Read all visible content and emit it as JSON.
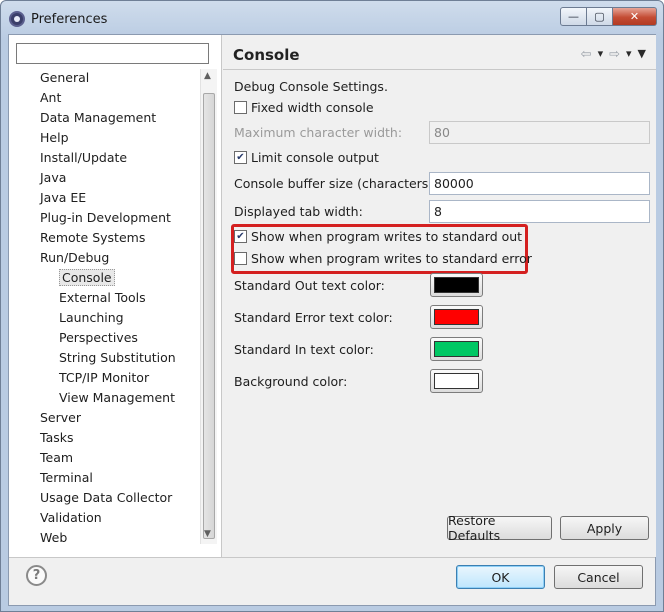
{
  "window": {
    "title": "Preferences",
    "min_glyph": "—",
    "max_glyph": "▢",
    "close_glyph": "✕"
  },
  "filter": {
    "value": "",
    "placeholder": ""
  },
  "tree": {
    "items": [
      {
        "label": "General",
        "level": 0
      },
      {
        "label": "Ant",
        "level": 0
      },
      {
        "label": "Data Management",
        "level": 0
      },
      {
        "label": "Help",
        "level": 0
      },
      {
        "label": "Install/Update",
        "level": 0
      },
      {
        "label": "Java",
        "level": 0
      },
      {
        "label": "Java EE",
        "level": 0
      },
      {
        "label": "Plug-in Development",
        "level": 0
      },
      {
        "label": "Remote Systems",
        "level": 0
      },
      {
        "label": "Run/Debug",
        "level": 0
      },
      {
        "label": "Console",
        "level": 1,
        "selected": true
      },
      {
        "label": "External Tools",
        "level": 1
      },
      {
        "label": "Launching",
        "level": 1
      },
      {
        "label": "Perspectives",
        "level": 1
      },
      {
        "label": "String Substitution",
        "level": 1
      },
      {
        "label": "TCP/IP Monitor",
        "level": 1
      },
      {
        "label": "View Management",
        "level": 1
      },
      {
        "label": "Server",
        "level": 0
      },
      {
        "label": "Tasks",
        "level": 0
      },
      {
        "label": "Team",
        "level": 0
      },
      {
        "label": "Terminal",
        "level": 0
      },
      {
        "label": "Usage Data Collector",
        "level": 0
      },
      {
        "label": "Validation",
        "level": 0
      },
      {
        "label": "Web",
        "level": 0
      }
    ]
  },
  "page": {
    "title": "Console",
    "nav": {
      "back": "⇦",
      "back_menu": "▾",
      "forward": "⇨",
      "forward_menu": "▾",
      "view_menu": "▼"
    },
    "section_label": "Debug Console Settings.",
    "fixed_width": {
      "label": "Fixed width console",
      "checked": false
    },
    "max_char_width": {
      "label": "Maximum character width:",
      "value": "80"
    },
    "limit_output": {
      "label": "Limit console output",
      "checked": true
    },
    "buffer_size": {
      "label": "Console buffer size (characters):",
      "value": "80000"
    },
    "tab_width": {
      "label": "Displayed tab width:",
      "value": "8"
    },
    "show_stdout": {
      "label": "Show when program writes to standard out",
      "checked": true
    },
    "show_stderr": {
      "label": "Show when program writes to standard error",
      "checked": false
    },
    "colors": [
      {
        "label": "Standard Out text color:",
        "color": "#000000"
      },
      {
        "label": "Standard Error text color:",
        "color": "#ff0000"
      },
      {
        "label": "Standard In text color:",
        "color": "#00c864"
      },
      {
        "label": "Background color:",
        "color": "#ffffff"
      }
    ],
    "restore_defaults": "Restore Defaults",
    "apply": "Apply"
  },
  "footer": {
    "help_glyph": "?",
    "ok": "OK",
    "cancel": "Cancel"
  }
}
